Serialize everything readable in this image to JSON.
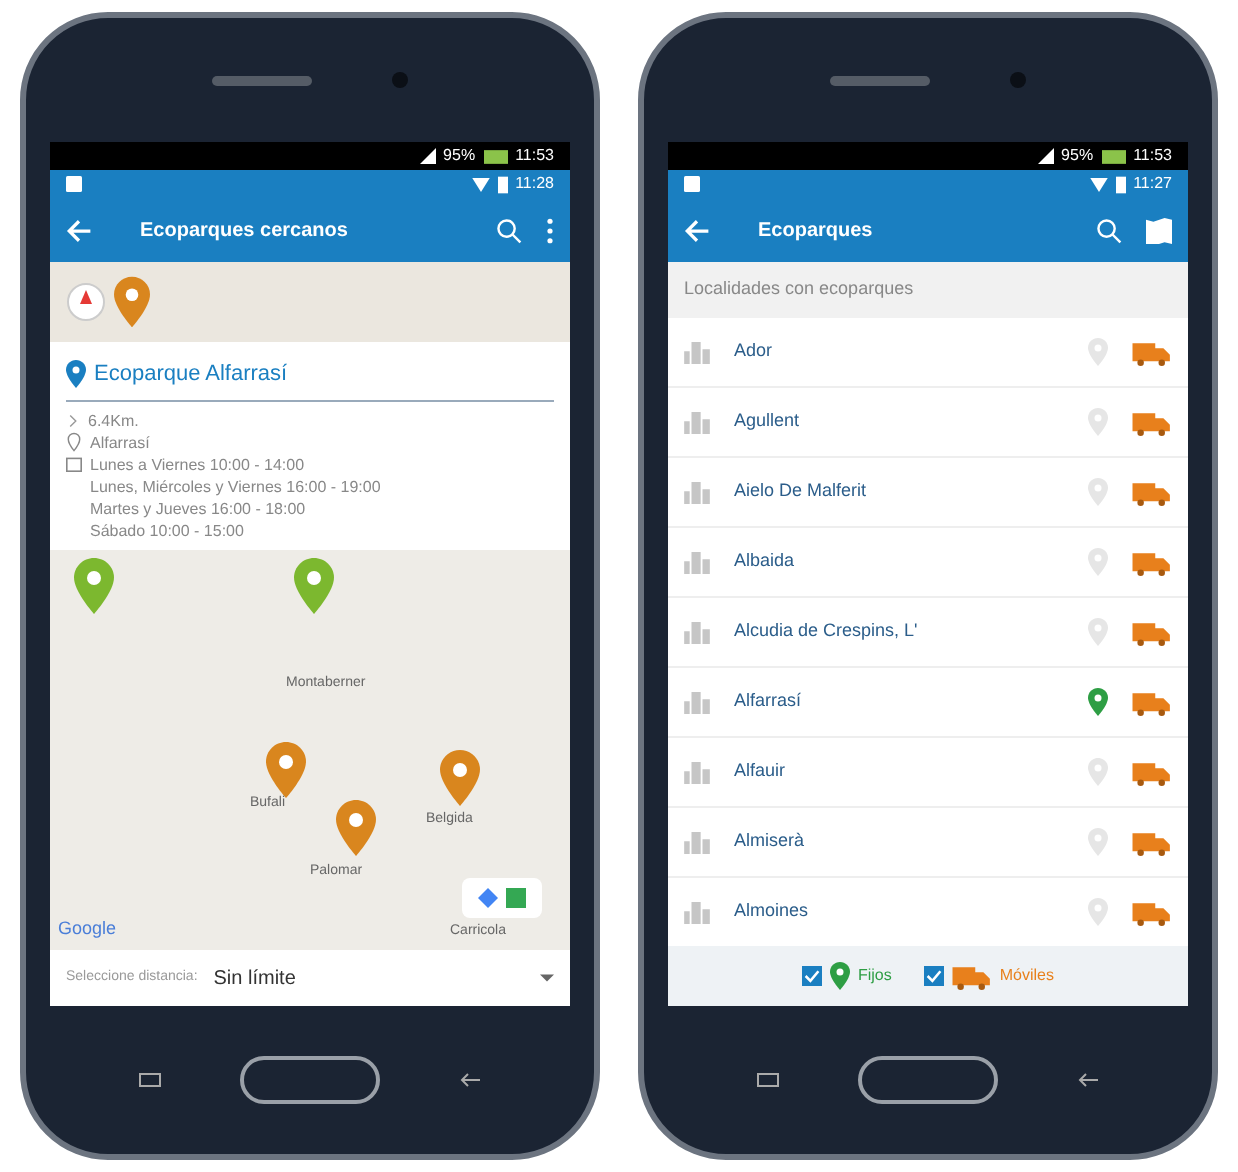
{
  "phones": [
    {
      "kind": "map",
      "device_status": {
        "battery": "95%",
        "time": "11:53"
      },
      "app_status": {
        "time": "11:28"
      },
      "toolbar": {
        "title": "Ecoparques cercanos"
      },
      "card": {
        "title": "Ecoparque Alfarrasí",
        "distance": "6.4Km.",
        "town": "Alfarrasí",
        "hours": [
          "Lunes a Viernes 10:00 - 14:00",
          "Lunes, Miércoles y Viernes 16:00 - 19:00",
          "Martes y Jueves 16:00 - 18:00",
          "Sábado 10:00 - 15:00"
        ]
      },
      "map": {
        "places": [
          "Montaberner",
          "Bufali",
          "Palomar",
          "Belgida",
          "Carricola"
        ],
        "pins": [
          {
            "color": "#7cb82f"
          },
          {
            "color": "#7cb82f"
          },
          {
            "color": "#d9861e"
          },
          {
            "color": "#d9861e"
          },
          {
            "color": "#d9861e"
          }
        ],
        "logo": "Google"
      },
      "distance": {
        "label": "Seleccione distancia:",
        "value": "Sin límite"
      }
    },
    {
      "kind": "list",
      "device_status": {
        "battery": "95%",
        "time": "11:53"
      },
      "app_status": {
        "time": "11:27"
      },
      "toolbar": {
        "title": "Ecoparques"
      },
      "subheader": "Localidades con ecoparques",
      "rows": [
        {
          "name": "Ador",
          "fixed": false
        },
        {
          "name": "Agullent",
          "fixed": false
        },
        {
          "name": "Aielo De Malferit",
          "fixed": false
        },
        {
          "name": "Albaida",
          "fixed": false
        },
        {
          "name": "Alcudia de Crespins, L'",
          "fixed": false
        },
        {
          "name": "Alfarrasí",
          "fixed": true
        },
        {
          "name": "Alfauir",
          "fixed": false
        },
        {
          "name": "Almiserà",
          "fixed": false
        },
        {
          "name": "Almoines",
          "fixed": false
        }
      ],
      "filters": [
        {
          "label": "Fijos",
          "kind": "fixed",
          "checked": true
        },
        {
          "label": "Móviles",
          "kind": "mobile",
          "checked": true
        }
      ]
    }
  ]
}
